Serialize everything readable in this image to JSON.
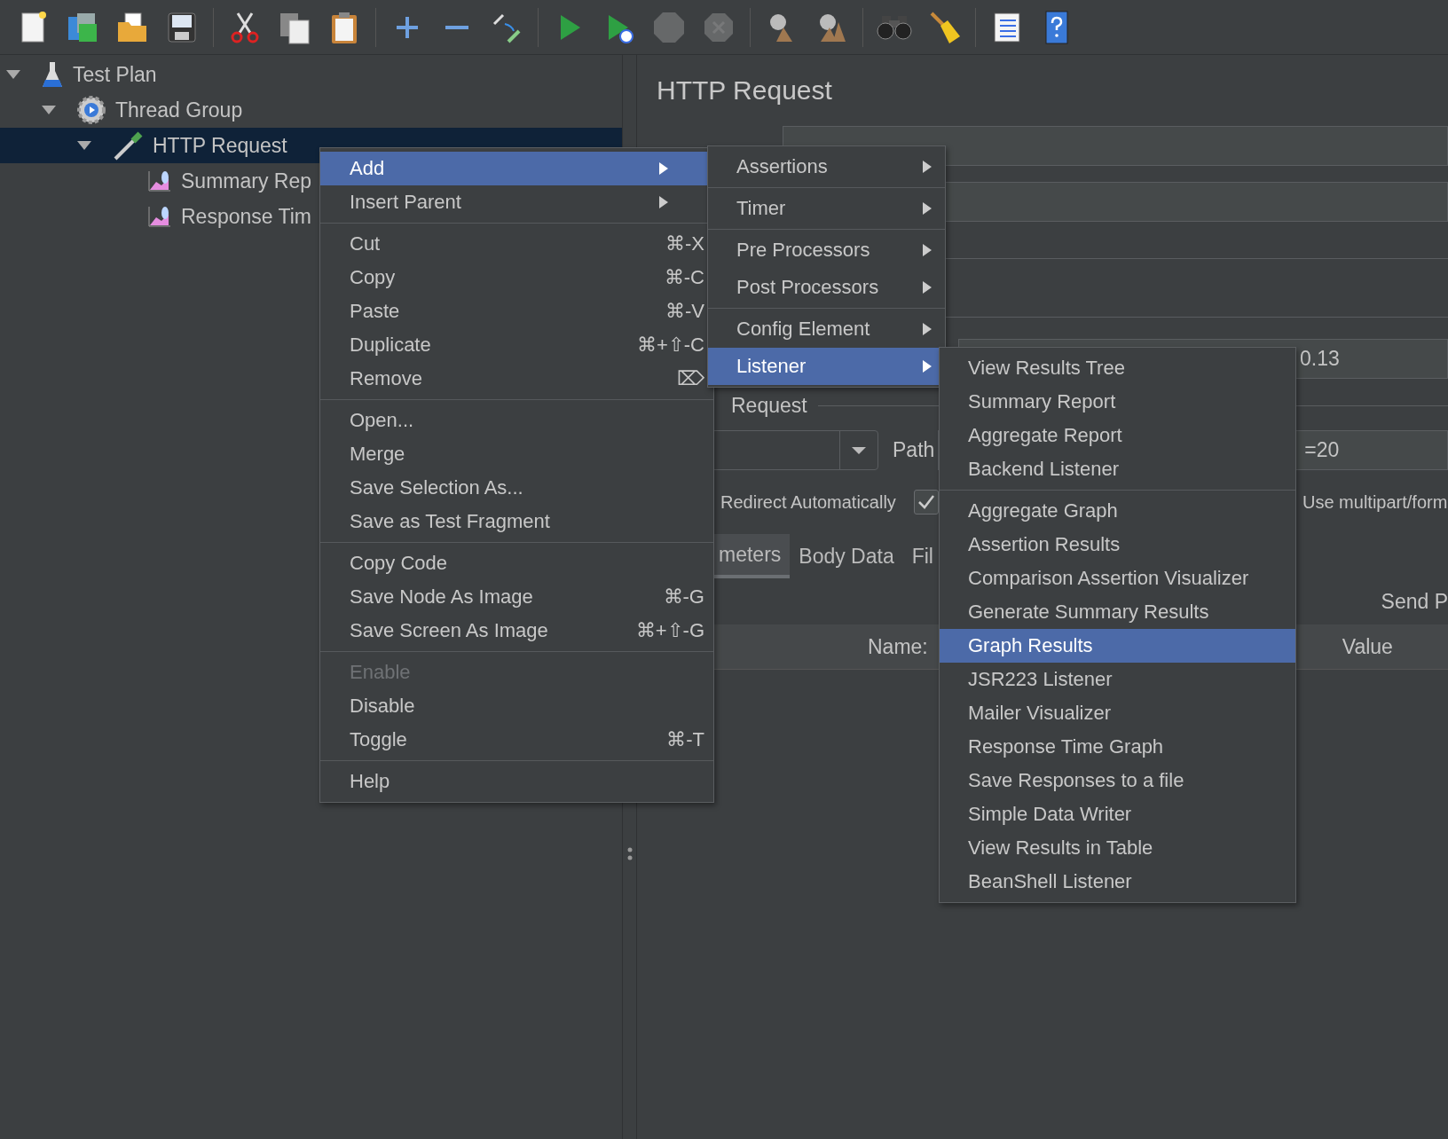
{
  "toolbar": {
    "groups": [
      {
        "buttons": [
          {
            "disabled": false
          },
          {
            "disabled": false
          },
          {
            "disabled": false
          },
          {
            "disabled": false
          }
        ]
      },
      {
        "buttons": [
          {
            "disabled": false
          },
          {
            "disabled": false
          },
          {
            "disabled": false
          }
        ]
      },
      {
        "buttons": [
          {
            "disabled": false
          },
          {
            "disabled": false
          },
          {
            "disabled": false
          }
        ]
      },
      {
        "buttons": [
          {
            "disabled": false
          },
          {
            "disabled": false
          },
          {
            "disabled": true
          },
          {
            "disabled": true
          }
        ]
      },
      {
        "buttons": [
          {
            "disabled": false
          },
          {
            "disabled": false
          }
        ]
      },
      {
        "buttons": [
          {
            "disabled": false
          },
          {
            "disabled": false
          }
        ]
      },
      {
        "buttons": [
          {
            "disabled": false
          },
          {
            "disabled": false
          }
        ]
      }
    ]
  },
  "tree": [
    {
      "label": "Test Plan",
      "kind": "plan",
      "expanded": true,
      "selected": false,
      "children": [
        {
          "label": "Thread Group",
          "kind": "threads",
          "expanded": true,
          "selected": false,
          "children": [
            {
              "label": "HTTP Request",
              "kind": "sampler",
              "expanded": true,
              "selected": true,
              "children": [
                {
                  "label": "Summary Rep",
                  "kind": "listener",
                  "selected": false
                },
                {
                  "label": "Response Tim",
                  "kind": "listener",
                  "selected": false
                }
              ]
            }
          ]
        }
      ]
    }
  ],
  "editor": {
    "title": "HTTP Request",
    "legend": "Request",
    "server_value": "0.13",
    "path_label": "Path",
    "path_value": "=20",
    "redirect_label": "Redirect Automatically",
    "redirect_checked": true,
    "multipart_label": "Use multipart/form",
    "tabs": [
      {
        "label": "meters",
        "selected": true
      },
      {
        "label": "Body Data",
        "selected": false
      },
      {
        "label": "Fil",
        "selected": false
      }
    ],
    "send_label": "Send P",
    "columns": [
      "Name:",
      "Value"
    ]
  },
  "context_menu": {
    "sections": [
      {
        "items": [
          {
            "label": "Add",
            "submenu": true,
            "selected": true,
            "disabled": false
          },
          {
            "label": "Insert Parent",
            "submenu": true,
            "selected": false,
            "disabled": false
          }
        ]
      },
      {
        "items": [
          {
            "label": "Cut",
            "shortcut": "⌘-X",
            "selected": false,
            "disabled": false
          },
          {
            "label": "Copy",
            "shortcut": "⌘-C",
            "selected": false,
            "disabled": false
          },
          {
            "label": "Paste",
            "shortcut": "⌘-V",
            "selected": false,
            "disabled": false
          },
          {
            "label": "Duplicate",
            "shortcut": "⌘+⇧-C",
            "selected": false,
            "disabled": false
          },
          {
            "label": "Remove",
            "shortcut": "⌦",
            "selected": false,
            "disabled": false
          }
        ]
      },
      {
        "items": [
          {
            "label": "Open...",
            "selected": false,
            "disabled": false
          },
          {
            "label": "Merge",
            "selected": false,
            "disabled": false
          },
          {
            "label": "Save Selection As...",
            "selected": false,
            "disabled": false
          },
          {
            "label": "Save as Test Fragment",
            "selected": false,
            "disabled": false
          }
        ]
      },
      {
        "items": [
          {
            "label": "Copy Code",
            "selected": false,
            "disabled": false
          },
          {
            "label": "Save Node As Image",
            "shortcut": "⌘-G",
            "selected": false,
            "disabled": false
          },
          {
            "label": "Save Screen As Image",
            "shortcut": "⌘+⇧-G",
            "selected": false,
            "disabled": false
          }
        ]
      },
      {
        "items": [
          {
            "label": "Enable",
            "selected": false,
            "disabled": true
          },
          {
            "label": "Disable",
            "selected": false,
            "disabled": false
          },
          {
            "label": "Toggle",
            "shortcut": "⌘-T",
            "selected": false,
            "disabled": false
          }
        ]
      },
      {
        "items": [
          {
            "label": "Help",
            "selected": false,
            "disabled": false
          }
        ]
      }
    ]
  },
  "add_submenu": {
    "sections": [
      {
        "items": [
          {
            "label": "Assertions",
            "submenu": true,
            "selected": false
          }
        ]
      },
      {
        "items": [
          {
            "label": "Timer",
            "submenu": true,
            "selected": false
          }
        ]
      },
      {
        "items": [
          {
            "label": "Pre Processors",
            "submenu": true,
            "selected": false
          },
          {
            "label": "Post Processors",
            "submenu": true,
            "selected": false
          }
        ]
      },
      {
        "items": [
          {
            "label": "Config Element",
            "submenu": true,
            "selected": false
          },
          {
            "label": "Listener",
            "submenu": true,
            "selected": true
          }
        ]
      }
    ]
  },
  "listener_submenu": {
    "sections": [
      {
        "items": [
          {
            "label": "View Results Tree",
            "selected": false
          },
          {
            "label": "Summary Report",
            "selected": false
          },
          {
            "label": "Aggregate Report",
            "selected": false
          },
          {
            "label": "Backend Listener",
            "selected": false
          }
        ]
      },
      {
        "items": [
          {
            "label": "Aggregate Graph",
            "selected": false
          },
          {
            "label": "Assertion Results",
            "selected": false
          },
          {
            "label": "Comparison Assertion Visualizer",
            "selected": false
          },
          {
            "label": "Generate Summary Results",
            "selected": false
          },
          {
            "label": "Graph Results",
            "selected": true
          },
          {
            "label": "JSR223 Listener",
            "selected": false
          },
          {
            "label": "Mailer Visualizer",
            "selected": false
          },
          {
            "label": "Response Time Graph",
            "selected": false
          },
          {
            "label": "Save Responses to a file",
            "selected": false
          },
          {
            "label": "Simple Data Writer",
            "selected": false
          },
          {
            "label": "View Results in Table",
            "selected": false
          },
          {
            "label": "BeanShell Listener",
            "selected": false
          }
        ]
      }
    ]
  }
}
